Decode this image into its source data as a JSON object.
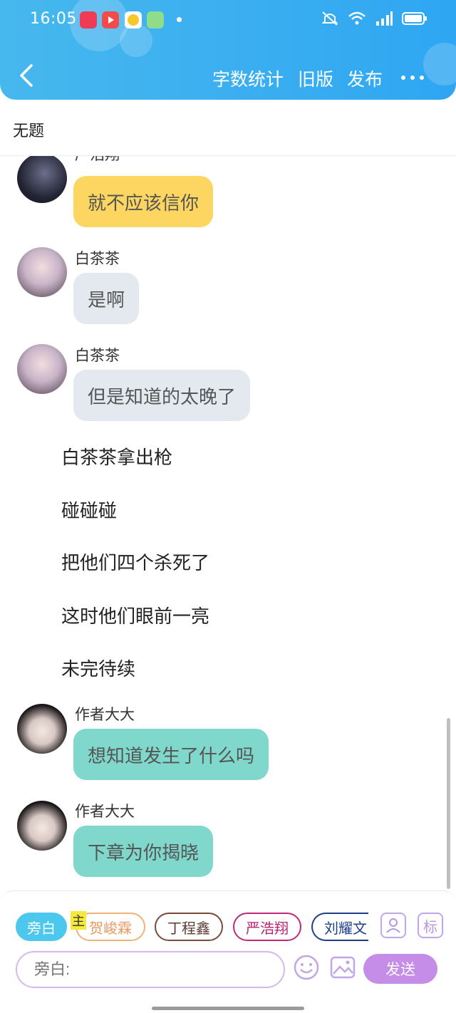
{
  "status": {
    "time": "16:05"
  },
  "nav": {
    "word_count": "字数统计",
    "old_version": "旧版",
    "publish": "发布"
  },
  "doc": {
    "title": "无题"
  },
  "messages": [
    {
      "sender": "严浩翔",
      "text": "就不应该信你",
      "color": "#fcd660"
    },
    {
      "sender": "白茶茶",
      "text": "是啊",
      "color": "#e4e9f0"
    },
    {
      "sender": "白茶茶",
      "text": "但是知道的太晚了",
      "color": "#e4e9f0"
    },
    {
      "sender": "作者大大",
      "text": "想知道发生了什么吗",
      "color": "#7fd8cb"
    },
    {
      "sender": "作者大大",
      "text": "下章为你揭晓",
      "color": "#7fd8cb"
    }
  ],
  "narration": [
    "白茶茶拿出枪",
    "碰碰碰",
    "把他们四个杀死了",
    "这时他们眼前一亮",
    "未完待续"
  ],
  "roles": [
    {
      "label": "旁白",
      "color": "#4cc7ee"
    },
    {
      "label": "贺峻霖",
      "color": "#f0b27a"
    },
    {
      "label": "丁程鑫",
      "color": "#7a4a3a"
    },
    {
      "label": "严浩翔",
      "color": "#c0287a"
    },
    {
      "label": "刘耀文",
      "color": "#1f3f8a"
    }
  ],
  "main_tag": "主",
  "tag_button": "标",
  "composer": {
    "placeholder": "旁白:",
    "send": "发送"
  }
}
